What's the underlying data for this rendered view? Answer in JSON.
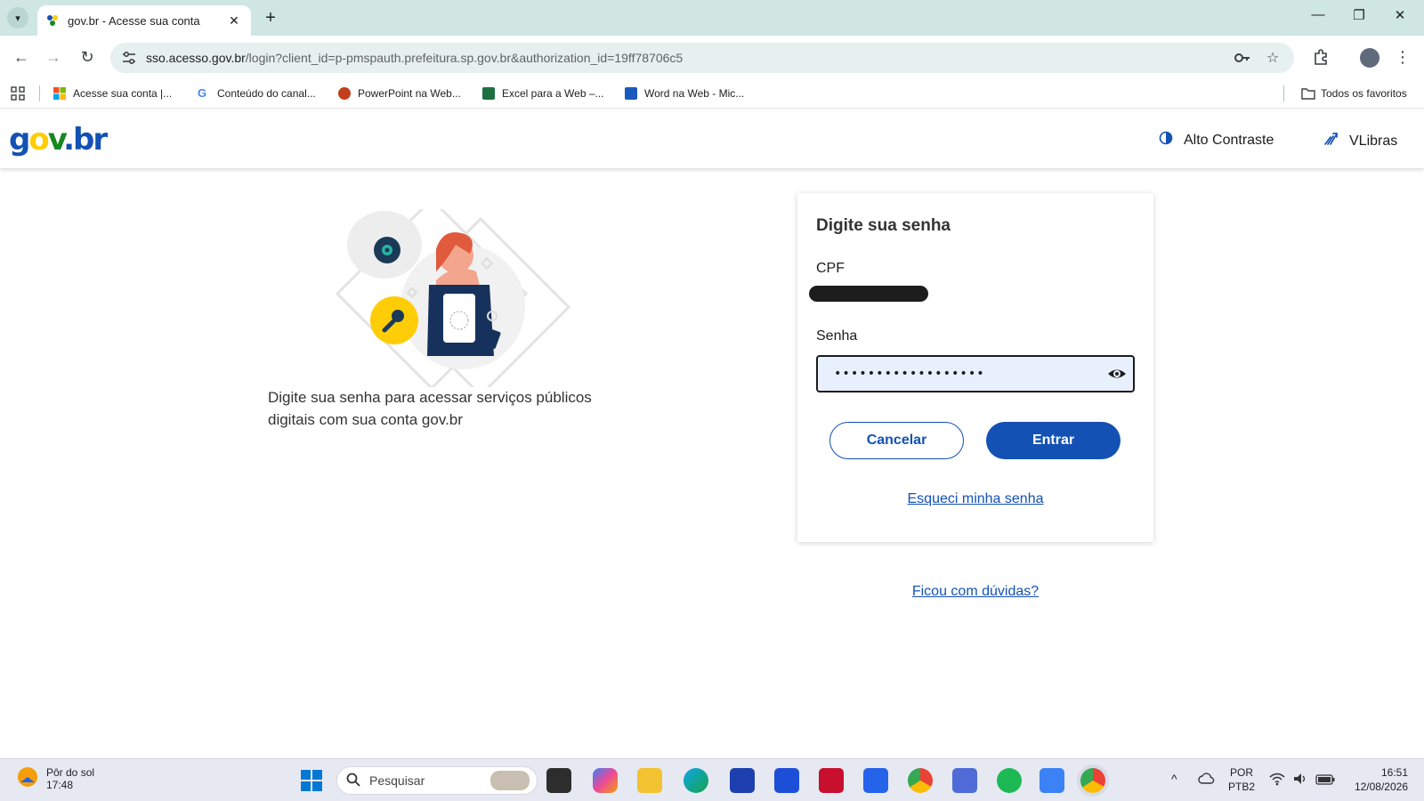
{
  "browser": {
    "tab_title": "gov.br - Acesse sua conta",
    "url_host": "sso.acesso.gov.br",
    "url_rest": "/login?client_id=p-pmspauth.prefeitura.sp.gov.br&authorization_id=19ff78706c5",
    "bookmarks": [
      {
        "label": "Acesse sua conta |...",
        "icon": "microsoft-logo-icon"
      },
      {
        "label": "Conteúdo do canal...",
        "icon": "google-logo-icon"
      },
      {
        "label": "PowerPoint na Web...",
        "icon": "powerpoint-icon"
      },
      {
        "label": "Excel para a Web –...",
        "icon": "excel-icon"
      },
      {
        "label": "Word na Web - Mic...",
        "icon": "word-icon"
      }
    ],
    "all_bookmarks_label": "Todos os favoritos"
  },
  "gov_header": {
    "logo_text": {
      "g": "g",
      "o": "o",
      "v": "v",
      "dot": ".",
      "b": "b",
      "r": "r"
    },
    "high_contrast_label": "Alto Contraste",
    "vlibras_label": "VLibras"
  },
  "intro": {
    "text": "Digite sua senha para acessar serviços públicos digitais com sua conta gov.br"
  },
  "login_card": {
    "title": "Digite sua senha",
    "cpf_label": "CPF",
    "password_label": "Senha",
    "password_value": "••••••••••••••••••",
    "cancel_label": "Cancelar",
    "enter_label": "Entrar",
    "forgot_label": "Esqueci minha senha"
  },
  "help_link": "Ficou com dúvidas?",
  "taskbar": {
    "weather_label": "Pôr do sol",
    "weather_time": "17:48",
    "search_placeholder": "Pesquisar",
    "lang_line1": "POR",
    "lang_line2": "PTB2",
    "time": "16:51",
    "date": "12/08/2026"
  },
  "colors": {
    "gov_blue": "#1351b4",
    "gov_yellow": "#ffcd07",
    "gov_green": "#168821"
  }
}
